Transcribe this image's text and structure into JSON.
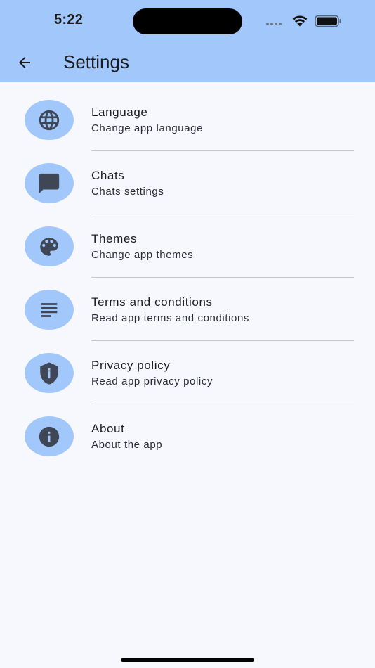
{
  "status_bar": {
    "time": "5:22"
  },
  "header": {
    "title": "Settings"
  },
  "settings": [
    {
      "title": "Language",
      "subtitle": "Change app language",
      "icon": "globe-icon"
    },
    {
      "title": "Chats",
      "subtitle": "Chats settings",
      "icon": "chat-bubble-icon"
    },
    {
      "title": "Themes",
      "subtitle": "Change app themes",
      "icon": "palette-icon"
    },
    {
      "title": "Terms and conditions",
      "subtitle": "Read app terms and conditions",
      "icon": "text-lines-icon"
    },
    {
      "title": "Privacy policy",
      "subtitle": "Read app privacy policy",
      "icon": "shield-icon"
    },
    {
      "title": "About",
      "subtitle": "About the app",
      "icon": "info-icon"
    }
  ],
  "colors": {
    "app_bar": "#a2c8fb",
    "icon_background": "#a2c8fb",
    "icon_foreground": "#3f4756",
    "page_background": "#f7f8fd"
  }
}
